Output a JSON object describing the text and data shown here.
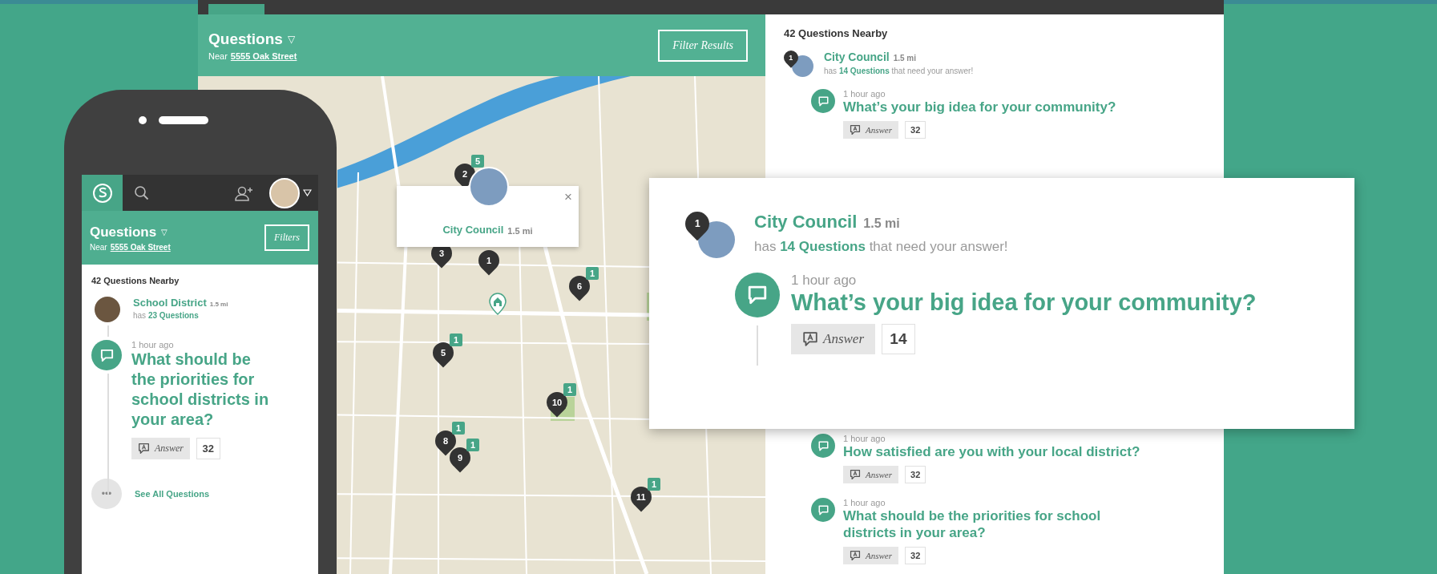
{
  "desktop": {
    "map_panel": {
      "title": "Questions",
      "caret": "▽",
      "near_prefix": "Near",
      "near_address": "5555 Oak Street",
      "filter_button": "Filter Results",
      "popup": {
        "name": "City Council",
        "distance": "1.5 mi",
        "close": "×"
      },
      "pins": [
        {
          "label": "2",
          "badge": "5"
        },
        {
          "label": "3"
        },
        {
          "label": "1"
        },
        {
          "label": "6",
          "badge": "1"
        },
        {
          "label": "5",
          "badge": "1"
        },
        {
          "label": "10",
          "badge": "1"
        },
        {
          "label": "8",
          "badge": "1"
        },
        {
          "label": "9",
          "badge": "1"
        },
        {
          "label": "11",
          "badge": "1"
        }
      ]
    },
    "list_panel": {
      "heading": "42 Questions Nearby",
      "group": {
        "pin": "1",
        "name": "City Council",
        "distance": "1.5 mi",
        "summary": "has **14 Questions** that need your answer!"
      },
      "questions": [
        {
          "time": "1 hour ago",
          "text": "What’s your big idea for your community?",
          "answer": "Answer",
          "count": "32"
        },
        {
          "time": "1 hour ago",
          "text": "How satisfied are you with your local district?",
          "answer": "Answer",
          "count": "32"
        },
        {
          "time": "1 hour ago",
          "text": "What should be the priorities for school districts in your area?",
          "answer": "Answer",
          "count": "32"
        }
      ]
    }
  },
  "featured_card": {
    "pin": "1",
    "name": "City Council",
    "distance": "1.5 mi",
    "summary": "has **14 Questions** that need your answer!",
    "question": {
      "time": "1 hour ago",
      "text": "What’s your big idea for your community?",
      "answer": "Answer",
      "count": "14"
    }
  },
  "phone": {
    "title": "Questions",
    "caret": "▽",
    "near_prefix": "Near",
    "near_address": "5555 Oak Street",
    "filter_button": "Filters",
    "heading": "42 Questions Nearby",
    "group": {
      "name": "School District",
      "distance": "1.5 mi",
      "summary": "has **23 Questions**"
    },
    "question": {
      "time": "1 hour ago",
      "text": "What should be the priorities for school districts in your area?",
      "answer": "Answer",
      "count": "32"
    },
    "more": "•••",
    "see_all": "See All Questions"
  }
}
